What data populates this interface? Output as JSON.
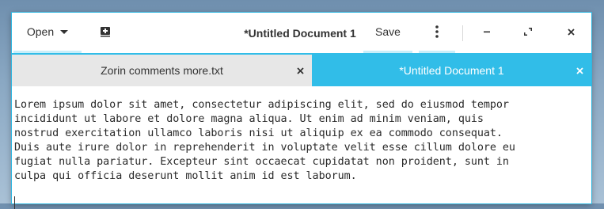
{
  "header": {
    "open_label": "Open",
    "new_document_icon": "new-document-icon",
    "title": "*Untitled Document 1",
    "save_label": "Save",
    "menu_icon": "vertical-dots-icon",
    "minimize_icon": "minimize-icon",
    "maximize_icon": "maximize-icon",
    "close_icon": "close-icon"
  },
  "tabs": [
    {
      "label": "Zorin comments more.txt",
      "active": false
    },
    {
      "label": "*Untitled Document 1",
      "active": true
    }
  ],
  "editor": {
    "lines": [
      "Lorem ipsum dolor sit amet, consectetur adipiscing elit, sed do eiusmod tempor",
      "incididunt ut labore et dolore magna aliqua. Ut enim ad minim veniam, quis",
      "nostrud exercitation ullamco laboris nisi ut aliquip ex ea commodo consequat.",
      "Duis aute irure dolor in reprehenderit in voluptate velit esse cillum dolore eu",
      "fugiat nulla pariatur. Excepteur sint occaecat cupidatat non proident, sunt in",
      "culpa qui officia deserunt mollit anim id est laborum."
    ]
  },
  "colors": {
    "accent": "#31bde8",
    "tab_inactive": "#e7e7e7",
    "text": "#2a2a2a"
  }
}
